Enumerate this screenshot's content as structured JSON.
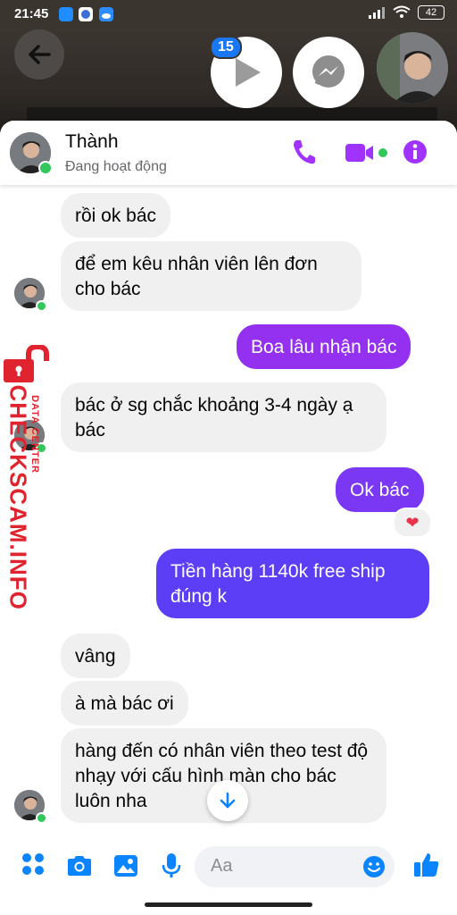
{
  "status_bar": {
    "time": "21:45",
    "battery": "42"
  },
  "chat_heads": {
    "unread_count": "15"
  },
  "header": {
    "contact_name": "Thành",
    "contact_status": "Đang hoạt động"
  },
  "messages": [
    {
      "side": "in",
      "text": "rồi ok bác"
    },
    {
      "side": "in",
      "text": "để em kêu nhân viên lên đơn cho bác"
    },
    {
      "side": "out",
      "text": "Boa lâu nhận bác"
    },
    {
      "side": "in",
      "text": "bác ở sg chắc khoảng 3-4 ngày ạ bác"
    },
    {
      "side": "out",
      "text": "Ok bác"
    },
    {
      "side": "out",
      "text": "Tiền hàng 1140k free ship đúng k"
    },
    {
      "side": "in",
      "text": "vâng"
    },
    {
      "side": "in",
      "text": "à mà bác ơi"
    },
    {
      "side": "in",
      "text": "hàng đến có nhân viên theo test độ nhạy với cấu hình màn cho bác luôn nha"
    }
  ],
  "reaction": "❤",
  "composer": {
    "placeholder": "Aa"
  },
  "watermark": {
    "brand": "CHECKSCAM.INFO",
    "sub": "DATA CENTER"
  },
  "colors": {
    "accent": "#a033ff",
    "out_bubble_top": "#9b2ff2",
    "out_bubble_bottom": "#5b3ef5",
    "icon_blue": "#0a84ff",
    "online": "#31c75a"
  }
}
